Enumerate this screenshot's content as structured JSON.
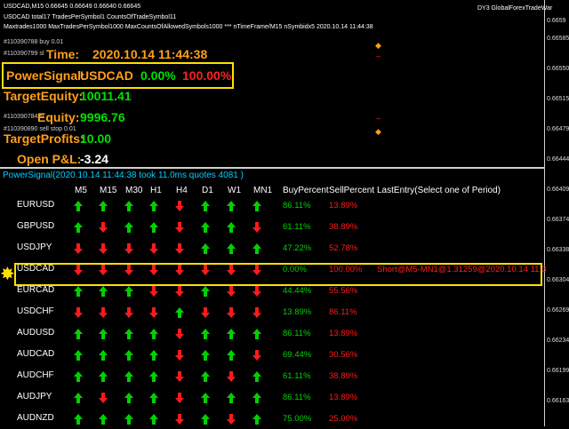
{
  "window": {
    "title": "USDCAD,M15 0.66645 0.66649 0.66640 0.66645",
    "right_title": "DY3 GlobalForexTradeWar"
  },
  "header_lines": {
    "line1": "USDCAD total17 TradesPerSymbol1 CountsOfTradeSymbol11",
    "line2": "Maxtrades1000 MaxTradesPerSymbol1000 MaxCountsOfAllowedSymbols1000 *** nTimeFrame/M15 nSymbidx5 2020.10.14 11:44:38"
  },
  "orders": {
    "o1": "#110390788 buy 0.01",
    "o2": "#110390799 sl",
    "o3": "#110390784 sl",
    "o4": "#110390890 sell stop 0.01"
  },
  "stats": {
    "time_label": "Time:",
    "time_value": "2020.10.14 11:44:38",
    "power_label": "PowerSignal:",
    "power_symbol": "USDCAD",
    "power_buy": "0.00%",
    "power_sell": "100.00%",
    "target_equity_label": "TargetEquity:",
    "target_equity_value": "10011.41",
    "equity_label": "Equity:",
    "equity_value": "9996.76",
    "target_profits_label": "TargetProfits:",
    "target_profits_value": "10.00",
    "open_pl_label": "Open P&L:",
    "open_pl_value": "-3.24"
  },
  "price_axis": [
    "0.6659",
    "0.66585",
    "0.66550",
    "0.66515",
    "0.66479",
    "0.66444",
    "0.66409",
    "0.66374",
    "0.66338",
    "0.66304",
    "0.66269",
    "0.66234",
    "0.66199",
    "0.66163"
  ],
  "panel": {
    "title": "PowerSignal(2020.10.14 11:44:38 took 11.0ms quotes 4081 )",
    "columns": {
      "periods": [
        "M5",
        "M15",
        "M30",
        "H1",
        "H4",
        "D1",
        "W1",
        "MN1"
      ],
      "buy": "BuyPercent",
      "sell": "SellPercent",
      "entry": "LastEntry(Select one of Period)"
    },
    "rows": [
      {
        "symbol": "EURUSD",
        "arrows": [
          "up",
          "up",
          "up",
          "up",
          "down",
          "up",
          "up",
          "up"
        ],
        "buy": "86.11%",
        "sell": "13.89%",
        "entry": ""
      },
      {
        "symbol": "GBPUSD",
        "arrows": [
          "up",
          "down",
          "up",
          "up",
          "down",
          "up",
          "up",
          "down"
        ],
        "buy": "61.11%",
        "sell": "38.89%",
        "entry": ""
      },
      {
        "symbol": "USDJPY",
        "arrows": [
          "down",
          "down",
          "down",
          "down",
          "down",
          "up",
          "up",
          "up"
        ],
        "buy": "47.22%",
        "sell": "52.78%",
        "entry": ""
      },
      {
        "symbol": "USDCAD",
        "arrows": [
          "down",
          "down",
          "down",
          "down",
          "down",
          "down",
          "down",
          "down"
        ],
        "buy": "0.00%",
        "sell": "100.00%",
        "entry": "Short@M5-MN1@1.31259@2020.10.14 11:3"
      },
      {
        "symbol": "EURCAD",
        "arrows": [
          "up",
          "up",
          "up",
          "down",
          "down",
          "up",
          "down",
          "down"
        ],
        "buy": "44.44%",
        "sell": "55.56%",
        "entry": ""
      },
      {
        "symbol": "USDCHF",
        "arrows": [
          "down",
          "down",
          "down",
          "down",
          "up",
          "down",
          "down",
          "down"
        ],
        "buy": "13.89%",
        "sell": "86.11%",
        "entry": ""
      },
      {
        "symbol": "AUDUSD",
        "arrows": [
          "up",
          "up",
          "up",
          "up",
          "down",
          "up",
          "up",
          "up"
        ],
        "buy": "86.11%",
        "sell": "13.89%",
        "entry": ""
      },
      {
        "symbol": "AUDCAD",
        "arrows": [
          "up",
          "up",
          "up",
          "up",
          "down",
          "up",
          "up",
          "down"
        ],
        "buy": "69.44%",
        "sell": "30.56%",
        "entry": ""
      },
      {
        "symbol": "AUDCHF",
        "arrows": [
          "up",
          "up",
          "up",
          "up",
          "down",
          "up",
          "down",
          "up"
        ],
        "buy": "61.11%",
        "sell": "38.89%",
        "entry": ""
      },
      {
        "symbol": "AUDJPY",
        "arrows": [
          "up",
          "down",
          "up",
          "up",
          "down",
          "up",
          "up",
          "up"
        ],
        "buy": "86.11%",
        "sell": "13.89%",
        "entry": ""
      },
      {
        "symbol": "AUDNZD",
        "arrows": [
          "up",
          "up",
          "up",
          "up",
          "down",
          "up",
          "down",
          "up"
        ],
        "buy": "75.00%",
        "sell": "25.00%",
        "entry": ""
      }
    ]
  },
  "colors": {
    "up": "#00d000",
    "down": "#ff1a1a",
    "highlight": "#ffe000",
    "label": "#ff9f1a"
  }
}
